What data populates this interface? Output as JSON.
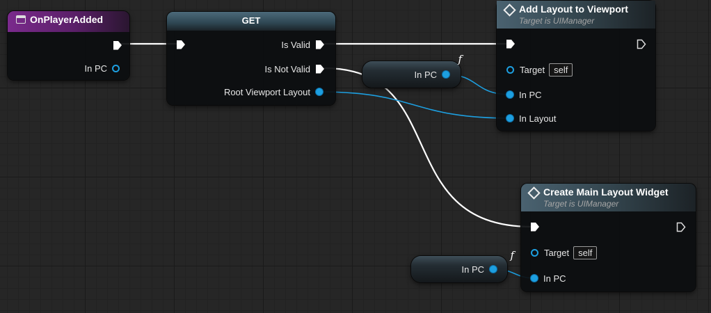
{
  "colors": {
    "event_header": "#6a1f7a",
    "get_header": "#3a5462",
    "function_header": "#3f5360",
    "exec_wire": "#ffffff",
    "object_wire": "#1d9fe0"
  },
  "nodes": {
    "event": {
      "title": "OnPlayerAdded",
      "icon": "event-icon",
      "pins": {
        "in_pc": "In PC"
      }
    },
    "get": {
      "title": "GET",
      "pins": {
        "is_valid": "Is Valid",
        "is_not_valid": "Is Not Valid",
        "root_viewport_layout": "Root Viewport Layout"
      }
    },
    "add_layout": {
      "title": "Add Layout to Viewport",
      "subtitle": "Target is UIManager",
      "icon": "function-icon",
      "pins": {
        "target": "Target",
        "target_value": "self",
        "in_pc": "In PC",
        "in_layout": "In Layout"
      }
    },
    "create_layout": {
      "title": "Create Main Layout Widget",
      "subtitle": "Target is UIManager",
      "icon": "function-icon",
      "pins": {
        "target": "Target",
        "target_value": "self",
        "in_pc": "In PC"
      }
    },
    "var1": {
      "label": "In PC",
      "glyph": "f"
    },
    "var2": {
      "label": "In PC",
      "glyph": "f"
    }
  }
}
